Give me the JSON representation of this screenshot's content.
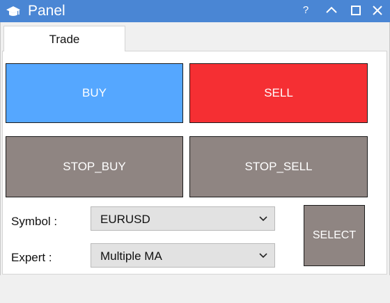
{
  "window": {
    "title": "Panel",
    "icon": "graduation-cap-icon",
    "help_label": "?",
    "controls": [
      "help-icon",
      "minimize-icon",
      "maximize-icon",
      "close-icon"
    ]
  },
  "tabs": [
    {
      "label": "Trade",
      "active": true
    }
  ],
  "buttons": {
    "buy": "BUY",
    "sell": "SELL",
    "stop_buy": "STOP_BUY",
    "stop_sell": "STOP_SELL",
    "select": "SELECT"
  },
  "fields": {
    "symbol": {
      "label": "Symbol :",
      "value": "EURUSD"
    },
    "expert": {
      "label": "Expert :",
      "value": "Multiple MA"
    }
  },
  "colors": {
    "titlebar": "#4a86d4",
    "buy": "#55a7ff",
    "sell": "#f52f33",
    "neutral_button": "#8f8582"
  }
}
